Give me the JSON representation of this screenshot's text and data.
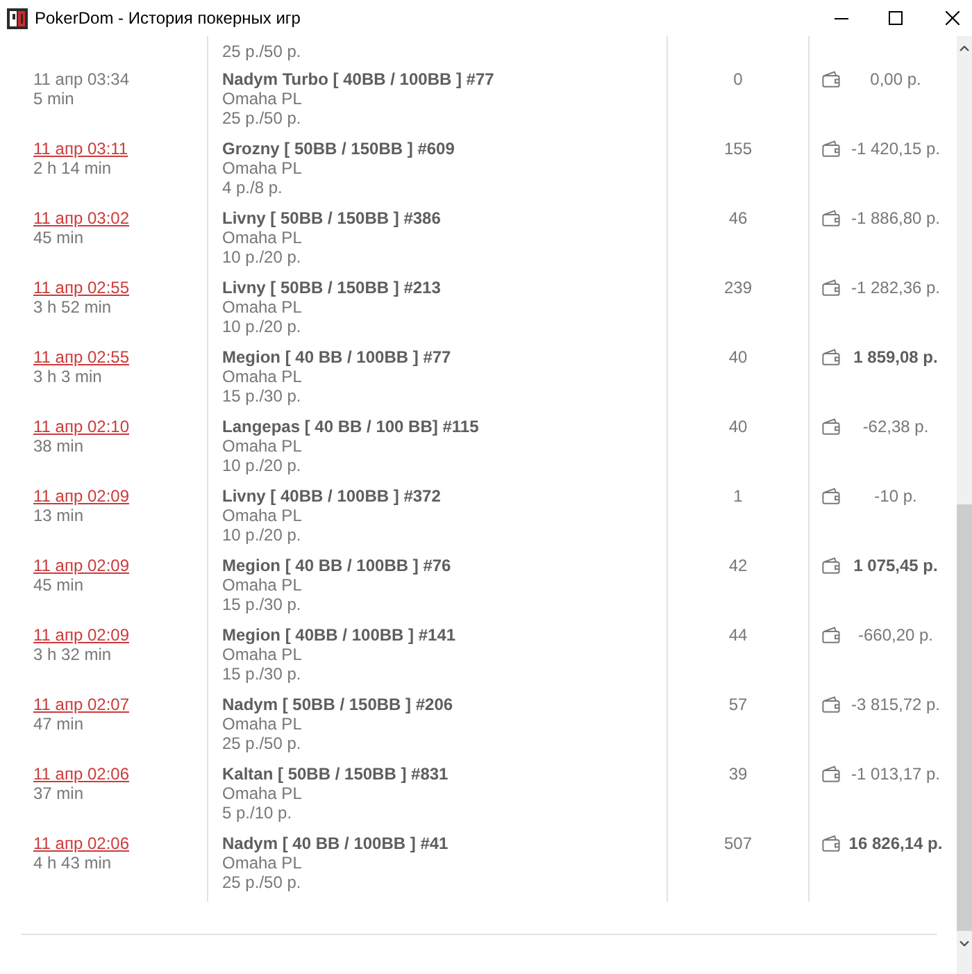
{
  "window": {
    "title": "PokerDom - История покерных игр"
  },
  "rows": [
    {
      "stakes": "25 р./50 р."
    },
    {
      "date": "11 апр 03:34",
      "linked": false,
      "duration": "5 min",
      "table": "Nadym Turbo [ 40BB / 100BB ] #77",
      "game": "Omaha PL",
      "stakes": "25 р./50 р.",
      "hands": "0",
      "amount": "0,00 р.",
      "won": false
    },
    {
      "date": "11 апр 03:11",
      "linked": true,
      "duration": "2 h 14 min",
      "table": "Grozny [ 50BB / 150BB ] #609",
      "game": "Omaha PL",
      "stakes": "4 р./8 р.",
      "hands": "155",
      "amount": "-1 420,15 р.",
      "won": false
    },
    {
      "date": "11 апр 03:02",
      "linked": true,
      "duration": "45 min",
      "table": "Livny [ 50BB / 150BB ] #386",
      "game": "Omaha PL",
      "stakes": "10 р./20 р.",
      "hands": "46",
      "amount": "-1 886,80 р.",
      "won": false
    },
    {
      "date": "11 апр 02:55",
      "linked": true,
      "duration": "3 h 52 min",
      "table": "Livny [ 50BB / 150BB ] #213",
      "game": "Omaha PL",
      "stakes": "10 р./20 р.",
      "hands": "239",
      "amount": "-1 282,36 р.",
      "won": false
    },
    {
      "date": "11 апр 02:55",
      "linked": true,
      "duration": "3 h 3 min",
      "table": "Megion [ 40 BB / 100BB ] #77",
      "game": "Omaha PL",
      "stakes": "15 р./30 р.",
      "hands": "40",
      "amount": "1 859,08 р.",
      "won": true
    },
    {
      "date": "11 апр 02:10",
      "linked": true,
      "duration": "38 min",
      "table": "Langepas [ 40 BB / 100 BB] #115",
      "game": "Omaha PL",
      "stakes": "10 р./20 р.",
      "hands": "40",
      "amount": "-62,38 р.",
      "won": false
    },
    {
      "date": "11 апр 02:09",
      "linked": true,
      "duration": "13 min",
      "table": "Livny [ 40BB / 100BB ] #372",
      "game": "Omaha PL",
      "stakes": "10 р./20 р.",
      "hands": "1",
      "amount": "-10 р.",
      "won": false
    },
    {
      "date": "11 апр 02:09",
      "linked": true,
      "duration": "45 min",
      "table": "Megion [ 40 BB / 100BB ] #76",
      "game": "Omaha PL",
      "stakes": "15 р./30 р.",
      "hands": "42",
      "amount": "1 075,45 р.",
      "won": true
    },
    {
      "date": "11 апр 02:09",
      "linked": true,
      "duration": "3 h 32 min",
      "table": "Megion [ 40BB / 100BB ] #141",
      "game": "Omaha PL",
      "stakes": "15 р./30 р.",
      "hands": "44",
      "amount": "-660,20 р.",
      "won": false
    },
    {
      "date": "11 апр 02:07",
      "linked": true,
      "duration": "47 min",
      "table": "Nadym [ 50BB / 150BB ] #206",
      "game": "Omaha PL",
      "stakes": "25 р./50 р.",
      "hands": "57",
      "amount": "-3 815,72 р.",
      "won": false
    },
    {
      "date": "11 апр 02:06",
      "linked": true,
      "duration": "37 min",
      "table": "Kaltan [ 50BB / 150BB ] #831",
      "game": "Omaha PL",
      "stakes": "5 р./10 р.",
      "hands": "39",
      "amount": "-1 013,17 р.",
      "won": false
    },
    {
      "date": "11 апр 02:06",
      "linked": true,
      "duration": "4 h 43 min",
      "table": "Nadym [ 40 BB / 100BB ] #41",
      "game": "Omaha PL",
      "stakes": "25 р./50 р.",
      "hands": "507",
      "amount": "16 826,14 р.",
      "won": true
    }
  ]
}
